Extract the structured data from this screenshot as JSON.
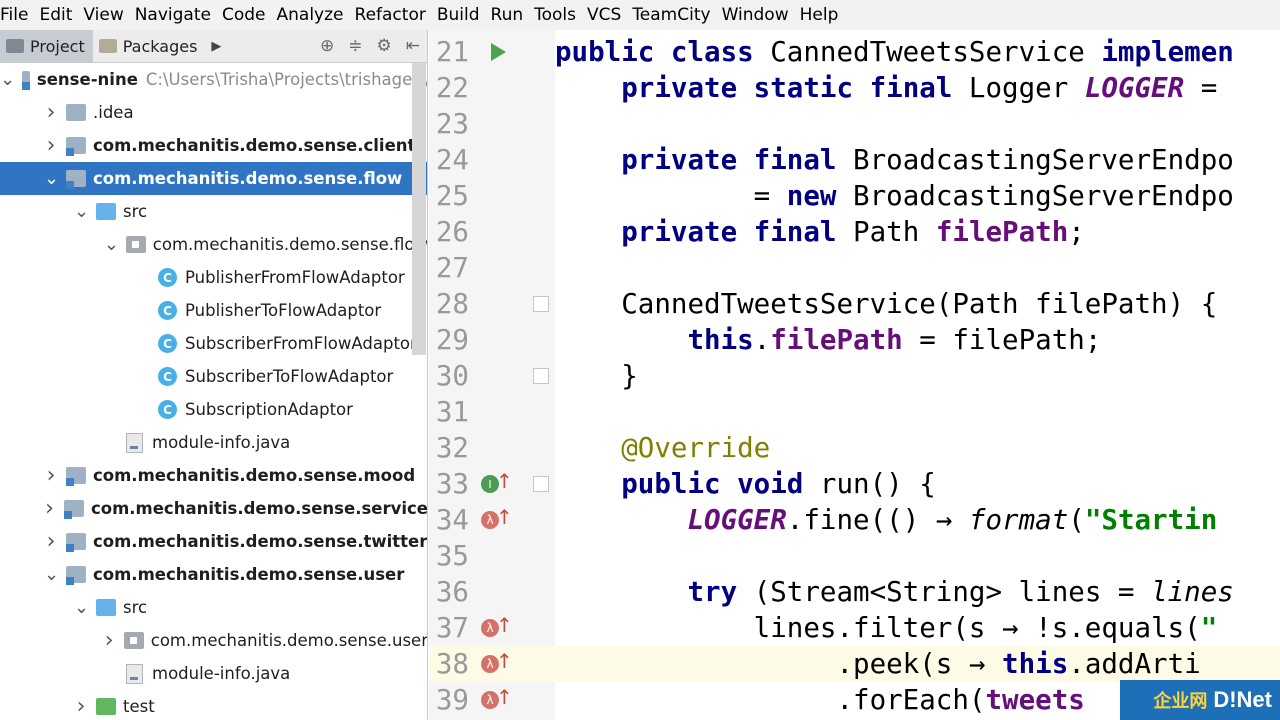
{
  "menu": [
    "File",
    "Edit",
    "View",
    "Navigate",
    "Code",
    "Analyze",
    "Refactor",
    "Build",
    "Run",
    "Tools",
    "VCS",
    "TeamCity",
    "Window",
    "Help"
  ],
  "panel": {
    "tabs": [
      {
        "label": "Project",
        "active": true
      },
      {
        "label": "Packages",
        "active": false
      }
    ]
  },
  "tree": [
    {
      "label": "sense-nine",
      "path": "C:\\Users\\Trisha\\Projects\\trishagee\\",
      "bold": true,
      "arrow": "⌄",
      "icon": "module-folder",
      "indent": 0
    },
    {
      "label": ".idea",
      "arrow": "›",
      "icon": "folder",
      "indent": 1
    },
    {
      "label": "com.mechanitis.demo.sense.client",
      "bold": true,
      "arrow": "›",
      "icon": "module-folder",
      "indent": 1
    },
    {
      "label": "com.mechanitis.demo.sense.flow",
      "bold": true,
      "arrow": "⌄",
      "icon": "module-folder",
      "indent": 1,
      "selected": true
    },
    {
      "label": "src",
      "arrow": "⌄",
      "icon": "source-folder",
      "indent": 2
    },
    {
      "label": "com.mechanitis.demo.sense.flow",
      "arrow": "⌄",
      "icon": "package",
      "indent": 3
    },
    {
      "label": "PublisherFromFlowAdaptor",
      "icon": "class",
      "indent": 4
    },
    {
      "label": "PublisherToFlowAdaptor",
      "icon": "class",
      "indent": 4
    },
    {
      "label": "SubscriberFromFlowAdaptor",
      "icon": "class",
      "indent": 4
    },
    {
      "label": "SubscriberToFlowAdaptor",
      "icon": "class",
      "indent": 4
    },
    {
      "label": "SubscriptionAdaptor",
      "icon": "class",
      "indent": 4
    },
    {
      "label": "module-info.java",
      "icon": "file",
      "indent": 3
    },
    {
      "label": "com.mechanitis.demo.sense.mood",
      "bold": true,
      "arrow": "›",
      "icon": "module-folder",
      "indent": 1
    },
    {
      "label": "com.mechanitis.demo.sense.service",
      "bold": true,
      "arrow": "›",
      "icon": "module-folder",
      "indent": 1
    },
    {
      "label": "com.mechanitis.demo.sense.twitter",
      "bold": true,
      "arrow": "›",
      "icon": "module-folder",
      "indent": 1
    },
    {
      "label": "com.mechanitis.demo.sense.user",
      "bold": true,
      "arrow": "⌄",
      "icon": "module-folder",
      "indent": 1
    },
    {
      "label": "src",
      "arrow": "⌄",
      "icon": "source-folder",
      "indent": 2
    },
    {
      "label": "com.mechanitis.demo.sense.user",
      "arrow": "›",
      "icon": "package",
      "indent": 3
    },
    {
      "label": "module-info.java",
      "icon": "file",
      "indent": 3
    },
    {
      "label": "test",
      "arrow": "›",
      "icon": "test-folder",
      "indent": 2
    }
  ],
  "editor": {
    "current_line": 38,
    "lines": [
      {
        "n": "21",
        "gutter": "run",
        "tokens": [
          [
            "kw",
            "public class "
          ],
          [
            "",
            "CannedTweetsService "
          ],
          [
            "kw",
            "implemen"
          ]
        ]
      },
      {
        "n": "22",
        "tokens": [
          [
            "",
            "    "
          ],
          [
            "kw",
            "private static final "
          ],
          [
            "",
            "Logger "
          ],
          [
            "sfld",
            "LOGGER"
          ],
          [
            "",
            " ="
          ]
        ]
      },
      {
        "n": "23",
        "tokens": []
      },
      {
        "n": "24",
        "tokens": [
          [
            "",
            "    "
          ],
          [
            "kw",
            "private final "
          ],
          [
            "",
            "BroadcastingServerEndpo"
          ]
        ]
      },
      {
        "n": "25",
        "tokens": [
          [
            "",
            "            = "
          ],
          [
            "kw",
            "new "
          ],
          [
            "",
            "BroadcastingServerEndpo"
          ]
        ]
      },
      {
        "n": "26",
        "tokens": [
          [
            "",
            "    "
          ],
          [
            "kw",
            "private final "
          ],
          [
            "",
            "Path "
          ],
          [
            "fld",
            "filePath"
          ],
          [
            "",
            ";"
          ]
        ]
      },
      {
        "n": "27",
        "tokens": []
      },
      {
        "n": "28",
        "fold": true,
        "tokens": [
          [
            "",
            "    CannedTweetsService(Path filePath) {"
          ]
        ]
      },
      {
        "n": "29",
        "tokens": [
          [
            "",
            "        "
          ],
          [
            "kw",
            "this"
          ],
          [
            "",
            "."
          ],
          [
            "fld",
            "filePath"
          ],
          [
            "",
            " = filePath;"
          ]
        ]
      },
      {
        "n": "30",
        "fold": true,
        "tokens": [
          [
            "",
            "    }"
          ]
        ]
      },
      {
        "n": "31",
        "tokens": []
      },
      {
        "n": "32",
        "tokens": [
          [
            "",
            "    "
          ],
          [
            "ann",
            "@Override"
          ]
        ]
      },
      {
        "n": "33",
        "gutter": "override",
        "fold": true,
        "tokens": [
          [
            "",
            "    "
          ],
          [
            "kw",
            "public void "
          ],
          [
            "",
            "run() {"
          ]
        ]
      },
      {
        "n": "34",
        "gutter": "lambda",
        "tokens": [
          [
            "",
            "        "
          ],
          [
            "sfld",
            "LOGGER"
          ],
          [
            "",
            ".fine(() → "
          ],
          [
            "ital",
            "format"
          ],
          [
            "",
            "("
          ],
          [
            "str",
            "\"Startin"
          ]
        ]
      },
      {
        "n": "35",
        "tokens": []
      },
      {
        "n": "36",
        "tokens": [
          [
            "",
            "        "
          ],
          [
            "kw",
            "try "
          ],
          [
            "",
            "(Stream<String> lines = "
          ],
          [
            "ital",
            "lines"
          ]
        ]
      },
      {
        "n": "37",
        "gutter": "lambda",
        "tokens": [
          [
            "",
            "            lines.filter(s → !s.equals("
          ],
          [
            "str",
            "\""
          ]
        ]
      },
      {
        "n": "38",
        "gutter": "lambda",
        "tokens": [
          [
            "",
            "                 .peek(s → "
          ],
          [
            "kw",
            "this"
          ],
          [
            "",
            ".addArti"
          ]
        ]
      },
      {
        "n": "39",
        "gutter": "lambda",
        "tokens": [
          [
            "",
            "                 .forEach("
          ],
          [
            "fld",
            "tweets"
          ]
        ]
      }
    ]
  },
  "watermark": {
    "left": "企业网",
    "right": "D!Net"
  }
}
